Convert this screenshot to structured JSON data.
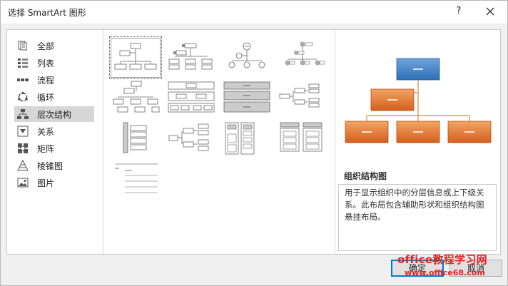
{
  "window": {
    "title": "选择 SmartArt 图形",
    "help_label": "?",
    "close_icon": "close-icon"
  },
  "categories": [
    {
      "label": "全部",
      "icon": "all-icon"
    },
    {
      "label": "列表",
      "icon": "list-icon"
    },
    {
      "label": "流程",
      "icon": "process-icon"
    },
    {
      "label": "循环",
      "icon": "cycle-icon"
    },
    {
      "label": "层次结构",
      "icon": "hierarchy-icon",
      "selected": true
    },
    {
      "label": "关系",
      "icon": "relationship-icon"
    },
    {
      "label": "矩阵",
      "icon": "matrix-icon"
    },
    {
      "label": "棱锥图",
      "icon": "pyramid-icon"
    },
    {
      "label": "图片",
      "icon": "picture-icon"
    }
  ],
  "gallery": {
    "selected_index": 0,
    "layouts": [
      "org-chart",
      "picture-org-chart",
      "name-title-org-chart",
      "circle-org-chart",
      "half-circle-org-chart",
      "hierarchy",
      "labeled-hierarchy",
      "table-hierarchy",
      "horizontal-hierarchy",
      "vertical-bracket-list",
      "horizontal-multi-level",
      "nested-list",
      "hierarchy-list",
      "lined-list"
    ]
  },
  "preview": {
    "title": "组织结构图",
    "description": "用于显示组织中的分层信息或上下级关系。此布局包含辅助形状和组织结构图悬挂布局。",
    "colors": {
      "top": "#2e6fb5",
      "top_light": "#6fa3dd",
      "orange": "#d45f1c",
      "orange_light": "#f2a565",
      "connector": "#e0844a"
    }
  },
  "buttons": {
    "ok": "确定",
    "cancel": "取消"
  },
  "watermark": {
    "line1": "office教程学习网",
    "line2": "www.office68.com"
  }
}
